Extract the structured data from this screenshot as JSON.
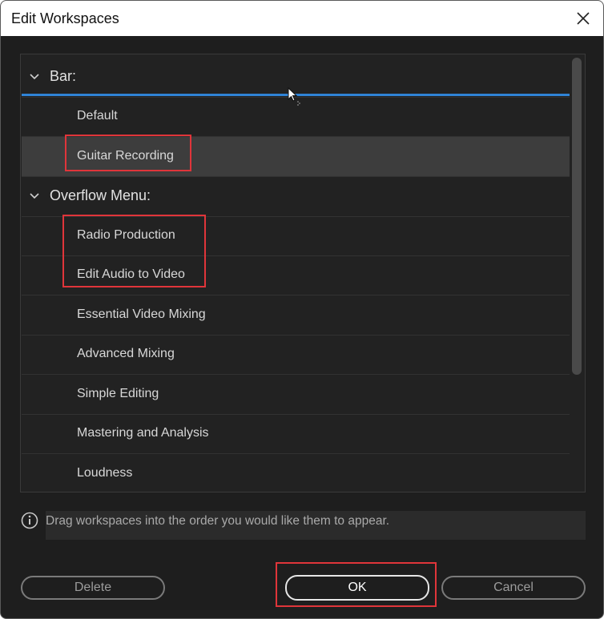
{
  "window": {
    "title": "Edit Workspaces",
    "close_icon": "close-icon"
  },
  "groups": [
    {
      "label": "Bar:",
      "icon": "chevron-down-icon"
    },
    {
      "label": "Overflow Menu:",
      "icon": "chevron-down-icon"
    }
  ],
  "bar_items": [
    "Default",
    "Guitar Recording"
  ],
  "overflow_items": [
    "Radio Production",
    "Edit Audio to Video",
    "Essential Video Mixing",
    "Advanced Mixing",
    "Simple Editing",
    "Mastering and Analysis",
    "Loudness"
  ],
  "selected_item": "Guitar Recording",
  "info": {
    "icon": "info-icon",
    "text": "Drag workspaces into the order you would like them to appear."
  },
  "buttons": {
    "delete": "Delete",
    "ok": "OK",
    "cancel": "Cancel"
  },
  "colors": {
    "drop_indicator": "#2f83d6",
    "highlight": "#e0353a",
    "selected_row": "#3d3d3d"
  }
}
